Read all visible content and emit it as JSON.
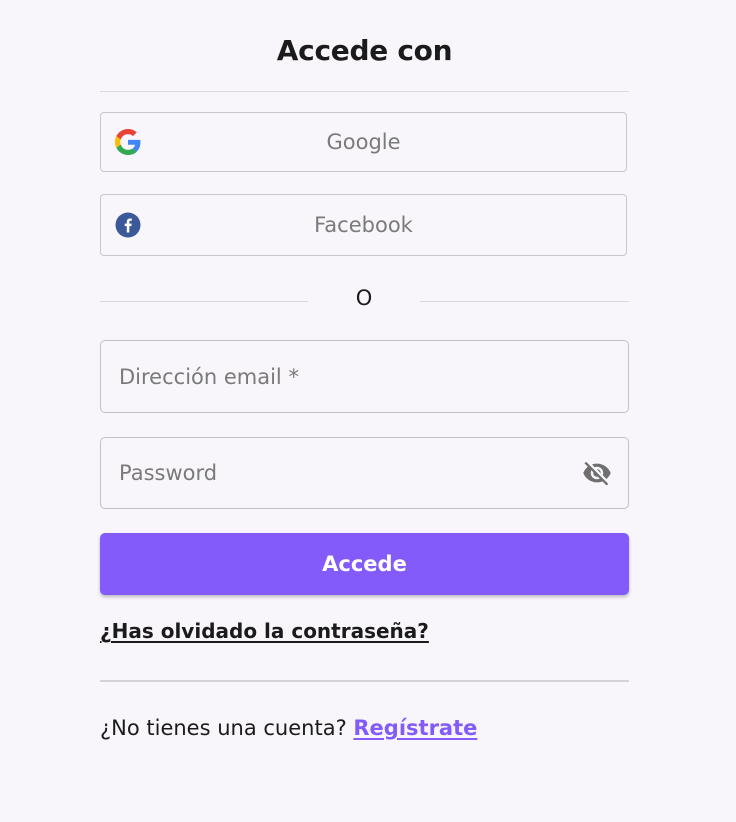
{
  "header": {
    "title": "Accede con"
  },
  "social": {
    "google_label": "Google",
    "facebook_label": "Facebook",
    "google_icon": "google-g-icon",
    "facebook_icon": "facebook-f-icon"
  },
  "divider": {
    "or_label": "O"
  },
  "form": {
    "email_placeholder": "Dirección email *",
    "email_value": "",
    "password_placeholder": "Password",
    "password_value": "",
    "password_toggle_icon": "eye-off-icon",
    "submit_label": "Accede"
  },
  "links": {
    "forgot_label": "¿Has olvidado la contraseña?",
    "no_account_text": "¿No tienes una cuenta? ",
    "register_label": "Regístrate"
  },
  "colors": {
    "accent": "#835bfb",
    "background": "#f8f6fb",
    "text": "#1b1b1b",
    "muted": "#7a7a7a",
    "border": "#c4c0c8",
    "facebook": "#3b5998"
  }
}
